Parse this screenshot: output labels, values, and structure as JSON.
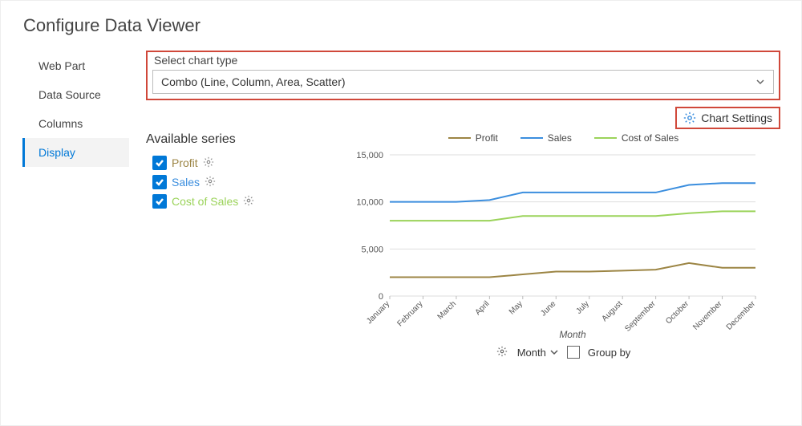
{
  "title": "Configure Data Viewer",
  "sidebar": {
    "items": [
      {
        "label": "Web Part"
      },
      {
        "label": "Data Source"
      },
      {
        "label": "Columns"
      },
      {
        "label": "Display"
      }
    ],
    "active_index": 3
  },
  "select_chart_type": {
    "label": "Select chart type",
    "value": "Combo (Line, Column, Area, Scatter)"
  },
  "chart_settings_label": "Chart Settings",
  "series_panel": {
    "title": "Available series",
    "items": [
      {
        "name": "Profit",
        "color": "#9c8544",
        "checked": true
      },
      {
        "name": "Sales",
        "color": "#3b8ede",
        "checked": true
      },
      {
        "name": "Cost of Sales",
        "color": "#9bd35a",
        "checked": true
      }
    ]
  },
  "chart_footer": {
    "axis_selector": "Month",
    "groupby_label": "Group by",
    "groupby_checked": false
  },
  "chart_data": {
    "type": "line",
    "title": "",
    "xlabel": "Month",
    "ylabel": "",
    "ylim": [
      0,
      15000
    ],
    "yticks": [
      0,
      5000,
      10000,
      15000
    ],
    "ytick_labels": [
      "0",
      "5,000",
      "10,000",
      "15,000"
    ],
    "categories": [
      "January",
      "February",
      "March",
      "April",
      "May",
      "June",
      "July",
      "August",
      "September",
      "October",
      "November",
      "December"
    ],
    "series": [
      {
        "name": "Profit",
        "color": "#9c8544",
        "values": [
          2000,
          2000,
          2000,
          2000,
          2300,
          2600,
          2600,
          2700,
          2800,
          3500,
          3000,
          3000
        ]
      },
      {
        "name": "Sales",
        "color": "#3b8ede",
        "values": [
          10000,
          10000,
          10000,
          10200,
          11000,
          11000,
          11000,
          11000,
          11000,
          11800,
          12000,
          12000
        ]
      },
      {
        "name": "Cost of Sales",
        "color": "#9bd35a",
        "values": [
          8000,
          8000,
          8000,
          8000,
          8500,
          8500,
          8500,
          8500,
          8500,
          8800,
          9000,
          9000
        ]
      }
    ],
    "legend_position": "top"
  }
}
